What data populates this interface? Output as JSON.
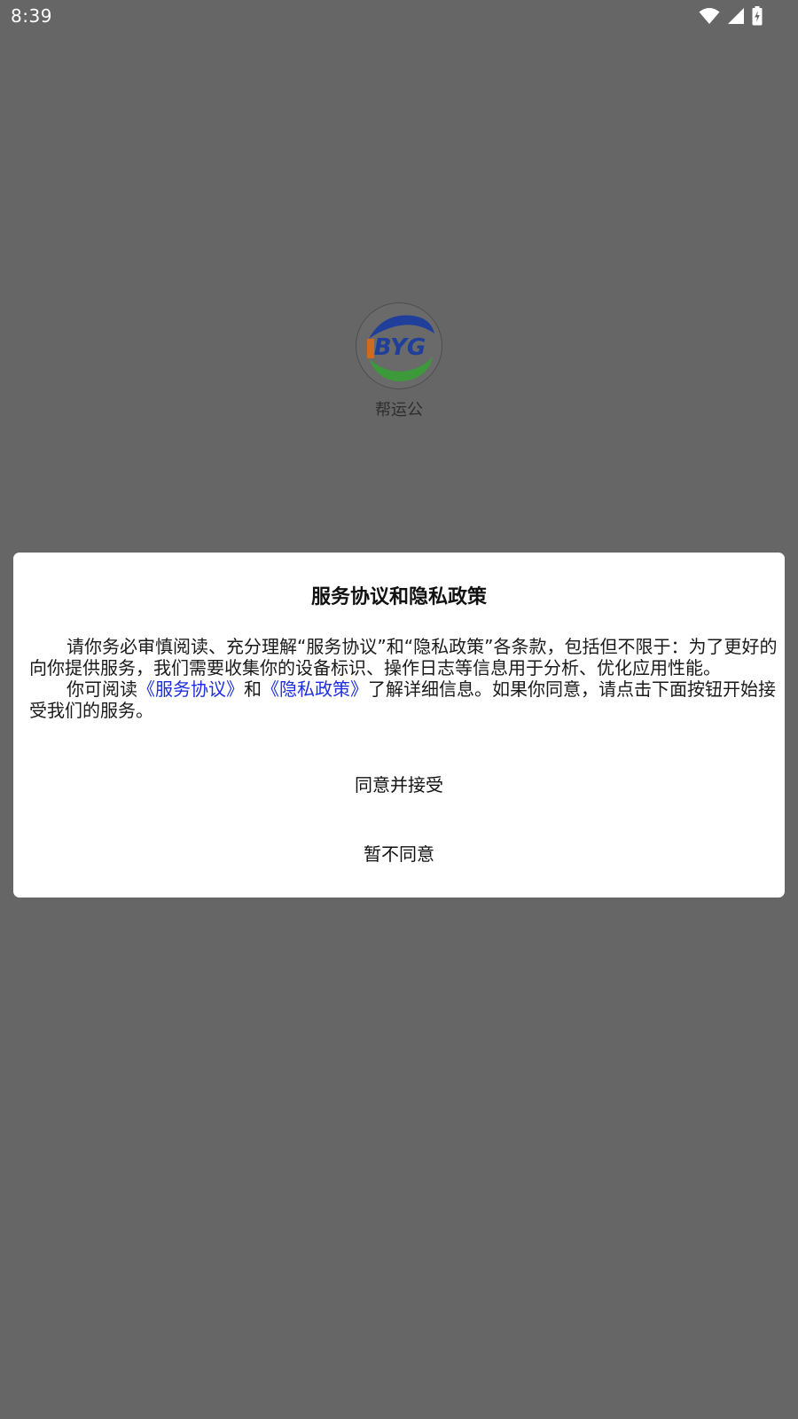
{
  "status_bar": {
    "time": "8:39",
    "icons": [
      "wifi-icon",
      "cellular-signal-icon",
      "battery-charging-icon"
    ]
  },
  "splash": {
    "app_name": "帮运公",
    "logo_text": "BYG"
  },
  "dialog": {
    "title": "服务协议和隐私政策",
    "paragraph1": "请你务必审慎阅读、充分理解“服务协议”和“隐私政策”各条款，包括但不限于：为了更好的向你提供服务，我们需要收集你的设备标识、操作日志等信息用于分析、优化应用性能。",
    "paragraph2_prefix": "你可阅读",
    "service_link": "《服务协议》",
    "paragraph2_mid": "和",
    "privacy_link": "《隐私政策》",
    "paragraph2_suffix": "了解详细信息。如果你同意，请点击下面按钮开始接受我们的服务。",
    "agree_button": "同意并接受",
    "decline_button": "暂不同意"
  },
  "colors": {
    "overlay": "#666666",
    "dialog_bg": "#ffffff",
    "link": "#1f2ee0",
    "logo_blue": "#1f3f9a",
    "logo_green": "#3d9a3a",
    "logo_orange": "#e06a10"
  }
}
